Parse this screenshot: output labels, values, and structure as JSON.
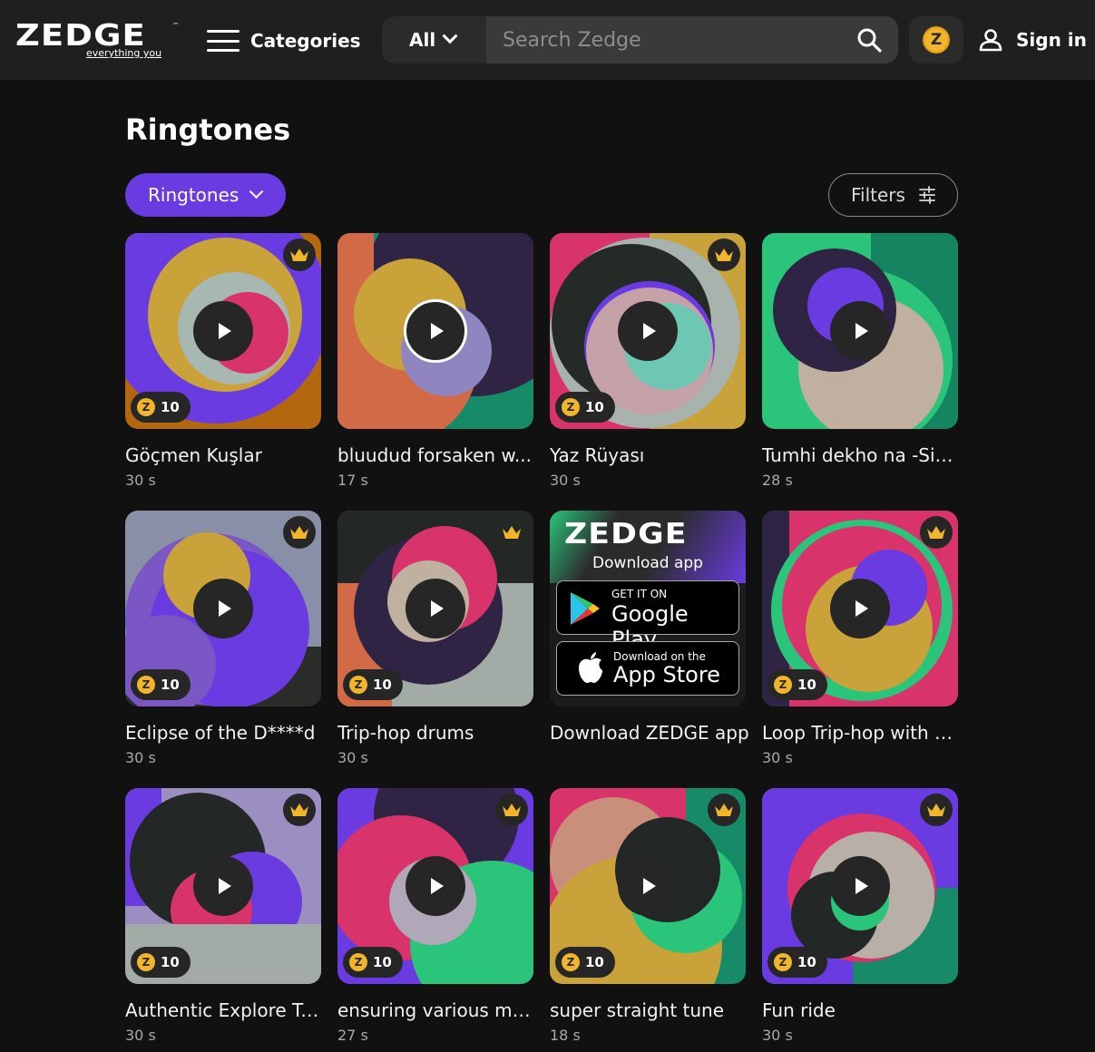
{
  "header": {
    "logo_text": "ZEDGE",
    "logo_tm": "™",
    "logo_tagline": "everything you",
    "categories_label": "Categories",
    "search_scope": "All",
    "search_placeholder": "Search Zedge",
    "coin_symbol": "Z",
    "signin_label": "Sign in"
  },
  "page": {
    "title": "Ringtones",
    "type_selector": "Ringtones",
    "filters_label": "Filters"
  },
  "colors": {
    "accent_purple": "#6a3be0",
    "coin_gold": "#f0b52a",
    "background": "#111112"
  },
  "cards": [
    {
      "title": "Göçmen Kuşlar",
      "duration": "30 s",
      "premium": true,
      "price": "10"
    },
    {
      "title": "bluudud forsaken w...",
      "duration": "17 s",
      "premium": false,
      "price": ""
    },
    {
      "title": "Yaz Rüyası",
      "duration": "30 s",
      "premium": true,
      "price": "10"
    },
    {
      "title": "Tumhi dekho na -Sitar",
      "duration": "28 s",
      "premium": false,
      "price": ""
    },
    {
      "title": "Eclipse of the D****d",
      "duration": "30 s",
      "premium": true,
      "price": "10"
    },
    {
      "title": "Trip-hop drums",
      "duration": "30 s",
      "premium": true,
      "price": "10"
    },
    {
      "title": "Loop Trip-hop with L...",
      "duration": "30 s",
      "premium": true,
      "price": "10"
    },
    {
      "title": "Authentic Explore Tu...",
      "duration": "30 s",
      "premium": true,
      "price": "10"
    },
    {
      "title": "ensuring various meth",
      "duration": "27 s",
      "premium": true,
      "price": "10"
    },
    {
      "title": "super straight tune",
      "duration": "18 s",
      "premium": true,
      "price": "10"
    },
    {
      "title": "Fun ride",
      "duration": "30 s",
      "premium": true,
      "price": "10"
    }
  ],
  "promo": {
    "logo_text": "ZEDGE",
    "subtitle": "Download app",
    "google_small": "GET IT ON",
    "google_big": "Google Play",
    "apple_small": "Download on the",
    "apple_big": "App Store",
    "title": "Download ZEDGE app"
  },
  "icons": {
    "menu": "hamburger-icon",
    "search": "search-icon",
    "user": "user-icon",
    "filters": "sliders-icon",
    "play": "play-icon",
    "crown": "crown-icon",
    "coin": "z-coin-icon"
  }
}
